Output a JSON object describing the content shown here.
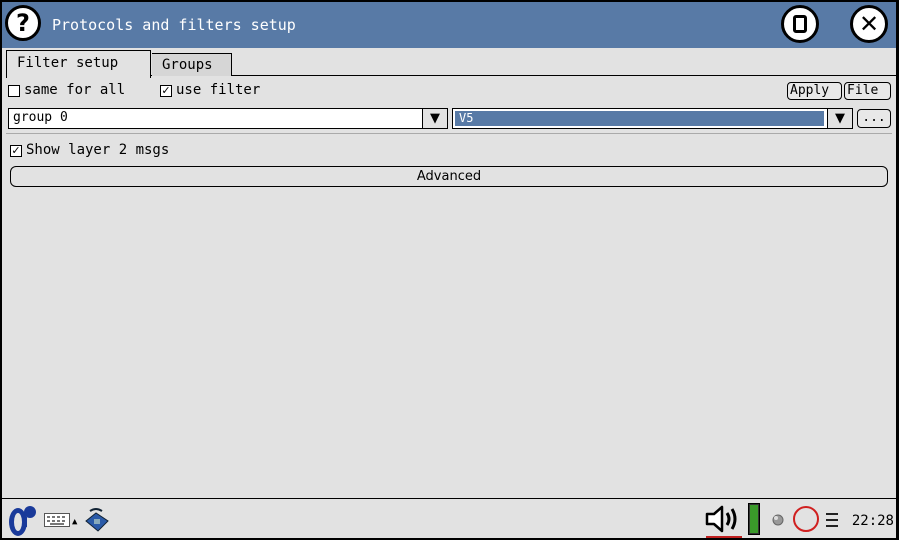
{
  "window": {
    "title": "Protocols and filters setup",
    "help_icon_text": "?"
  },
  "tabs": [
    {
      "label": "Filter setup",
      "active": true
    },
    {
      "label": "Groups",
      "active": false
    }
  ],
  "options": {
    "same_for_all_label": "same for all",
    "same_for_all_checked": false,
    "use_filter_label": "use filter",
    "use_filter_checked": true,
    "apply_label": "Apply",
    "file_label": "File"
  },
  "group_select": {
    "value": "group 0"
  },
  "protocol_select": {
    "value": "V5"
  },
  "ellipsis_label": "...",
  "show_layer2": {
    "label": "Show layer 2 msgs",
    "checked": true
  },
  "advanced_label": "Advanced",
  "taskbar": {
    "clock": "22:28"
  },
  "colors": {
    "titlebar": "#587aa6",
    "background": "#e2e2e2",
    "selection": "#587aa6",
    "battery": "#3a9a2a"
  },
  "icons": [
    "help-icon",
    "maximize-icon",
    "close-icon",
    "start-menu-icon",
    "keyboard-icon",
    "phone-icon",
    "speaker-icon",
    "battery-icon",
    "led-icon",
    "record-icon",
    "menu-icon"
  ]
}
